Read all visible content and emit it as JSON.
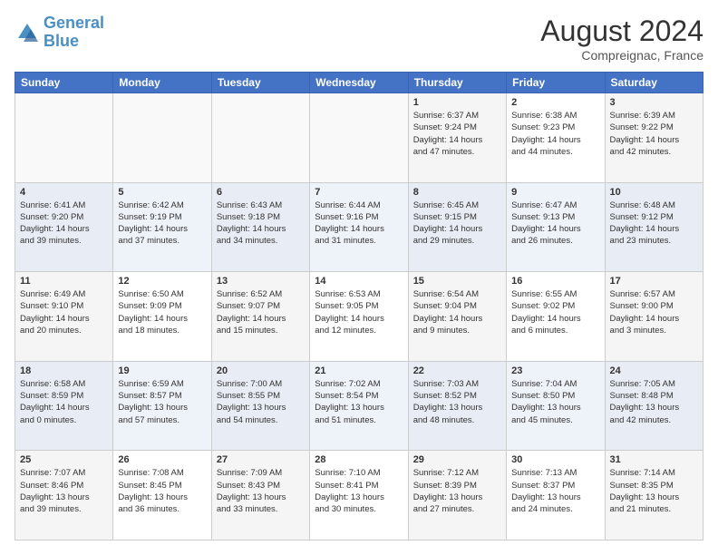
{
  "header": {
    "logo_line1": "General",
    "logo_line2": "Blue",
    "month": "August 2024",
    "location": "Compreignac, France"
  },
  "days_of_week": [
    "Sunday",
    "Monday",
    "Tuesday",
    "Wednesday",
    "Thursday",
    "Friday",
    "Saturday"
  ],
  "weeks": [
    [
      {
        "num": "",
        "info": ""
      },
      {
        "num": "",
        "info": ""
      },
      {
        "num": "",
        "info": ""
      },
      {
        "num": "",
        "info": ""
      },
      {
        "num": "1",
        "info": "Sunrise: 6:37 AM\nSunset: 9:24 PM\nDaylight: 14 hours\nand 47 minutes."
      },
      {
        "num": "2",
        "info": "Sunrise: 6:38 AM\nSunset: 9:23 PM\nDaylight: 14 hours\nand 44 minutes."
      },
      {
        "num": "3",
        "info": "Sunrise: 6:39 AM\nSunset: 9:22 PM\nDaylight: 14 hours\nand 42 minutes."
      }
    ],
    [
      {
        "num": "4",
        "info": "Sunrise: 6:41 AM\nSunset: 9:20 PM\nDaylight: 14 hours\nand 39 minutes."
      },
      {
        "num": "5",
        "info": "Sunrise: 6:42 AM\nSunset: 9:19 PM\nDaylight: 14 hours\nand 37 minutes."
      },
      {
        "num": "6",
        "info": "Sunrise: 6:43 AM\nSunset: 9:18 PM\nDaylight: 14 hours\nand 34 minutes."
      },
      {
        "num": "7",
        "info": "Sunrise: 6:44 AM\nSunset: 9:16 PM\nDaylight: 14 hours\nand 31 minutes."
      },
      {
        "num": "8",
        "info": "Sunrise: 6:45 AM\nSunset: 9:15 PM\nDaylight: 14 hours\nand 29 minutes."
      },
      {
        "num": "9",
        "info": "Sunrise: 6:47 AM\nSunset: 9:13 PM\nDaylight: 14 hours\nand 26 minutes."
      },
      {
        "num": "10",
        "info": "Sunrise: 6:48 AM\nSunset: 9:12 PM\nDaylight: 14 hours\nand 23 minutes."
      }
    ],
    [
      {
        "num": "11",
        "info": "Sunrise: 6:49 AM\nSunset: 9:10 PM\nDaylight: 14 hours\nand 20 minutes."
      },
      {
        "num": "12",
        "info": "Sunrise: 6:50 AM\nSunset: 9:09 PM\nDaylight: 14 hours\nand 18 minutes."
      },
      {
        "num": "13",
        "info": "Sunrise: 6:52 AM\nSunset: 9:07 PM\nDaylight: 14 hours\nand 15 minutes."
      },
      {
        "num": "14",
        "info": "Sunrise: 6:53 AM\nSunset: 9:05 PM\nDaylight: 14 hours\nand 12 minutes."
      },
      {
        "num": "15",
        "info": "Sunrise: 6:54 AM\nSunset: 9:04 PM\nDaylight: 14 hours\nand 9 minutes."
      },
      {
        "num": "16",
        "info": "Sunrise: 6:55 AM\nSunset: 9:02 PM\nDaylight: 14 hours\nand 6 minutes."
      },
      {
        "num": "17",
        "info": "Sunrise: 6:57 AM\nSunset: 9:00 PM\nDaylight: 14 hours\nand 3 minutes."
      }
    ],
    [
      {
        "num": "18",
        "info": "Sunrise: 6:58 AM\nSunset: 8:59 PM\nDaylight: 14 hours\nand 0 minutes."
      },
      {
        "num": "19",
        "info": "Sunrise: 6:59 AM\nSunset: 8:57 PM\nDaylight: 13 hours\nand 57 minutes."
      },
      {
        "num": "20",
        "info": "Sunrise: 7:00 AM\nSunset: 8:55 PM\nDaylight: 13 hours\nand 54 minutes."
      },
      {
        "num": "21",
        "info": "Sunrise: 7:02 AM\nSunset: 8:54 PM\nDaylight: 13 hours\nand 51 minutes."
      },
      {
        "num": "22",
        "info": "Sunrise: 7:03 AM\nSunset: 8:52 PM\nDaylight: 13 hours\nand 48 minutes."
      },
      {
        "num": "23",
        "info": "Sunrise: 7:04 AM\nSunset: 8:50 PM\nDaylight: 13 hours\nand 45 minutes."
      },
      {
        "num": "24",
        "info": "Sunrise: 7:05 AM\nSunset: 8:48 PM\nDaylight: 13 hours\nand 42 minutes."
      }
    ],
    [
      {
        "num": "25",
        "info": "Sunrise: 7:07 AM\nSunset: 8:46 PM\nDaylight: 13 hours\nand 39 minutes."
      },
      {
        "num": "26",
        "info": "Sunrise: 7:08 AM\nSunset: 8:45 PM\nDaylight: 13 hours\nand 36 minutes."
      },
      {
        "num": "27",
        "info": "Sunrise: 7:09 AM\nSunset: 8:43 PM\nDaylight: 13 hours\nand 33 minutes."
      },
      {
        "num": "28",
        "info": "Sunrise: 7:10 AM\nSunset: 8:41 PM\nDaylight: 13 hours\nand 30 minutes."
      },
      {
        "num": "29",
        "info": "Sunrise: 7:12 AM\nSunset: 8:39 PM\nDaylight: 13 hours\nand 27 minutes."
      },
      {
        "num": "30",
        "info": "Sunrise: 7:13 AM\nSunset: 8:37 PM\nDaylight: 13 hours\nand 24 minutes."
      },
      {
        "num": "31",
        "info": "Sunrise: 7:14 AM\nSunset: 8:35 PM\nDaylight: 13 hours\nand 21 minutes."
      }
    ]
  ]
}
